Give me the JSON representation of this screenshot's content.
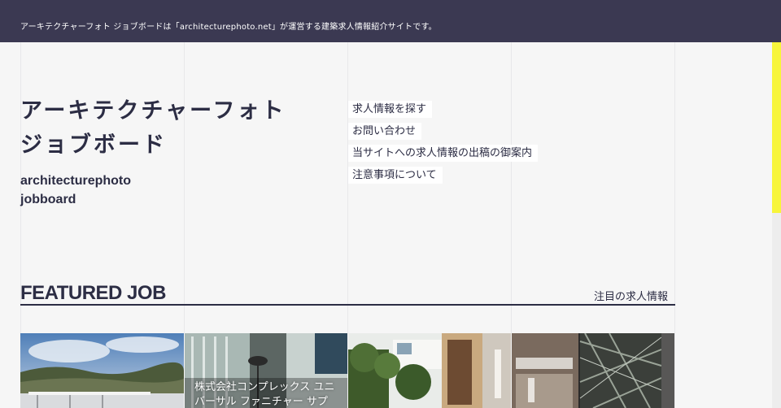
{
  "header": {
    "notice": "アーキテクチャーフォト ジョブボードは「architecturephoto.net」が運営する建築求人情報紹介サイトです。"
  },
  "brand": {
    "title_line1": "アーキテクチャーフォト",
    "title_line2": "ジョブボード",
    "en_line1": "architecturephoto",
    "en_line2": "jobboard"
  },
  "nav": {
    "items": [
      {
        "label": "求人情報を探す"
      },
      {
        "label": "お問い合わせ"
      },
      {
        "label": "当サイトへの求人情報の出稿の御案内"
      },
      {
        "label": "注意事項について"
      }
    ]
  },
  "featured": {
    "title": "FEATURED JOB",
    "subtitle": "注目の求人情報",
    "cards": [
      {
        "caption": ""
      },
      {
        "caption": "株式会社コンプレックス ユニバーサル ファニチャー サプ"
      },
      {
        "caption": ""
      },
      {
        "caption": ""
      }
    ]
  },
  "colors": {
    "topbar": "#3b3952",
    "text": "#2c2d44",
    "accent_scroll": "#f7f53a"
  }
}
